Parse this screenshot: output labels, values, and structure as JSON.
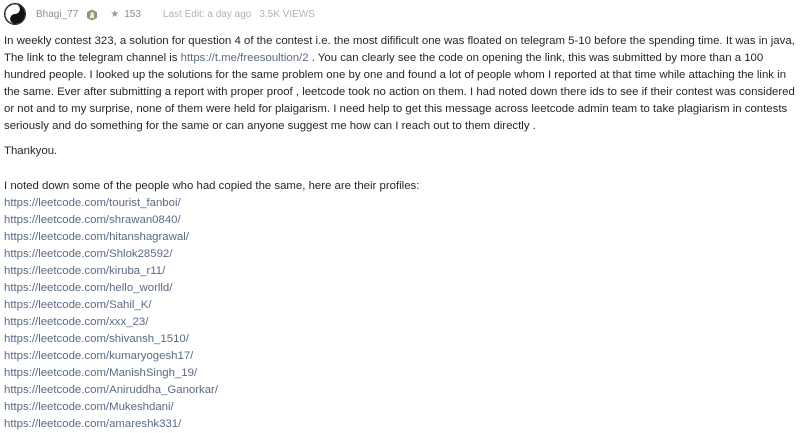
{
  "post": {
    "author": "Bhagi_77",
    "reputation": "153",
    "last_edit": "Last Edit: a day ago",
    "views": "3.5K VIEWS",
    "icons": {
      "avatar": "yin-yang-avatar-icon",
      "badge": "knight-badge-icon",
      "reputation": "star-icon"
    },
    "intro": {
      "part1": "In weekly contest 323, a solution for question 4 of the contest i.e. the most difificult one was floated on telegram 5-10 before the spending time. It was in java, The link to the telegram channel is ",
      "telegram_link": "https://t.me/freesoultion/2",
      "part2": " . You can clearly see the code on opening the link, this was submitted by more than a 100 hundred people. I looked up the solutions for the same problem one by one and found a lot of people whom I reported at that time while attaching the link in the same. Ever after submitting a report with proper proof , leetcode took no action on them. I had noted down there ids to see if their contest was considered or not and to my surprise, none of them were held for plaigarism. I need help to get this message across leetcode admin team to take plagiarism in contests seriously and do something for the same or can anyone suggest me how can I reach out to them directly ."
    },
    "thanks": "Thankyou.",
    "profiles_intro": "I noted down some of the people who had copied the same, here are their profiles:",
    "profiles": [
      "https://leetcode.com/tourist_fanboi/",
      "https://leetcode.com/shrawan0840/",
      "https://leetcode.com/hitanshagrawal/",
      "https://leetcode.com/Shlok28592/",
      "https://leetcode.com/kiruba_r11/",
      "https://leetcode.com/hello_worlld/",
      "https://leetcode.com/Sahil_K/",
      "https://leetcode.com/xxx_23/",
      "https://leetcode.com/shivansh_1510/",
      "https://leetcode.com/kumaryogesh17/",
      "https://leetcode.com/ManishSingh_19/",
      "https://leetcode.com/Aniruddha_Ganorkar/",
      "https://leetcode.com/Mukeshdani/",
      "https://leetcode.com/amareshk331/"
    ],
    "colors": {
      "link": "#5a6a86",
      "text": "#262626",
      "meta": "#b3b3b3"
    }
  }
}
